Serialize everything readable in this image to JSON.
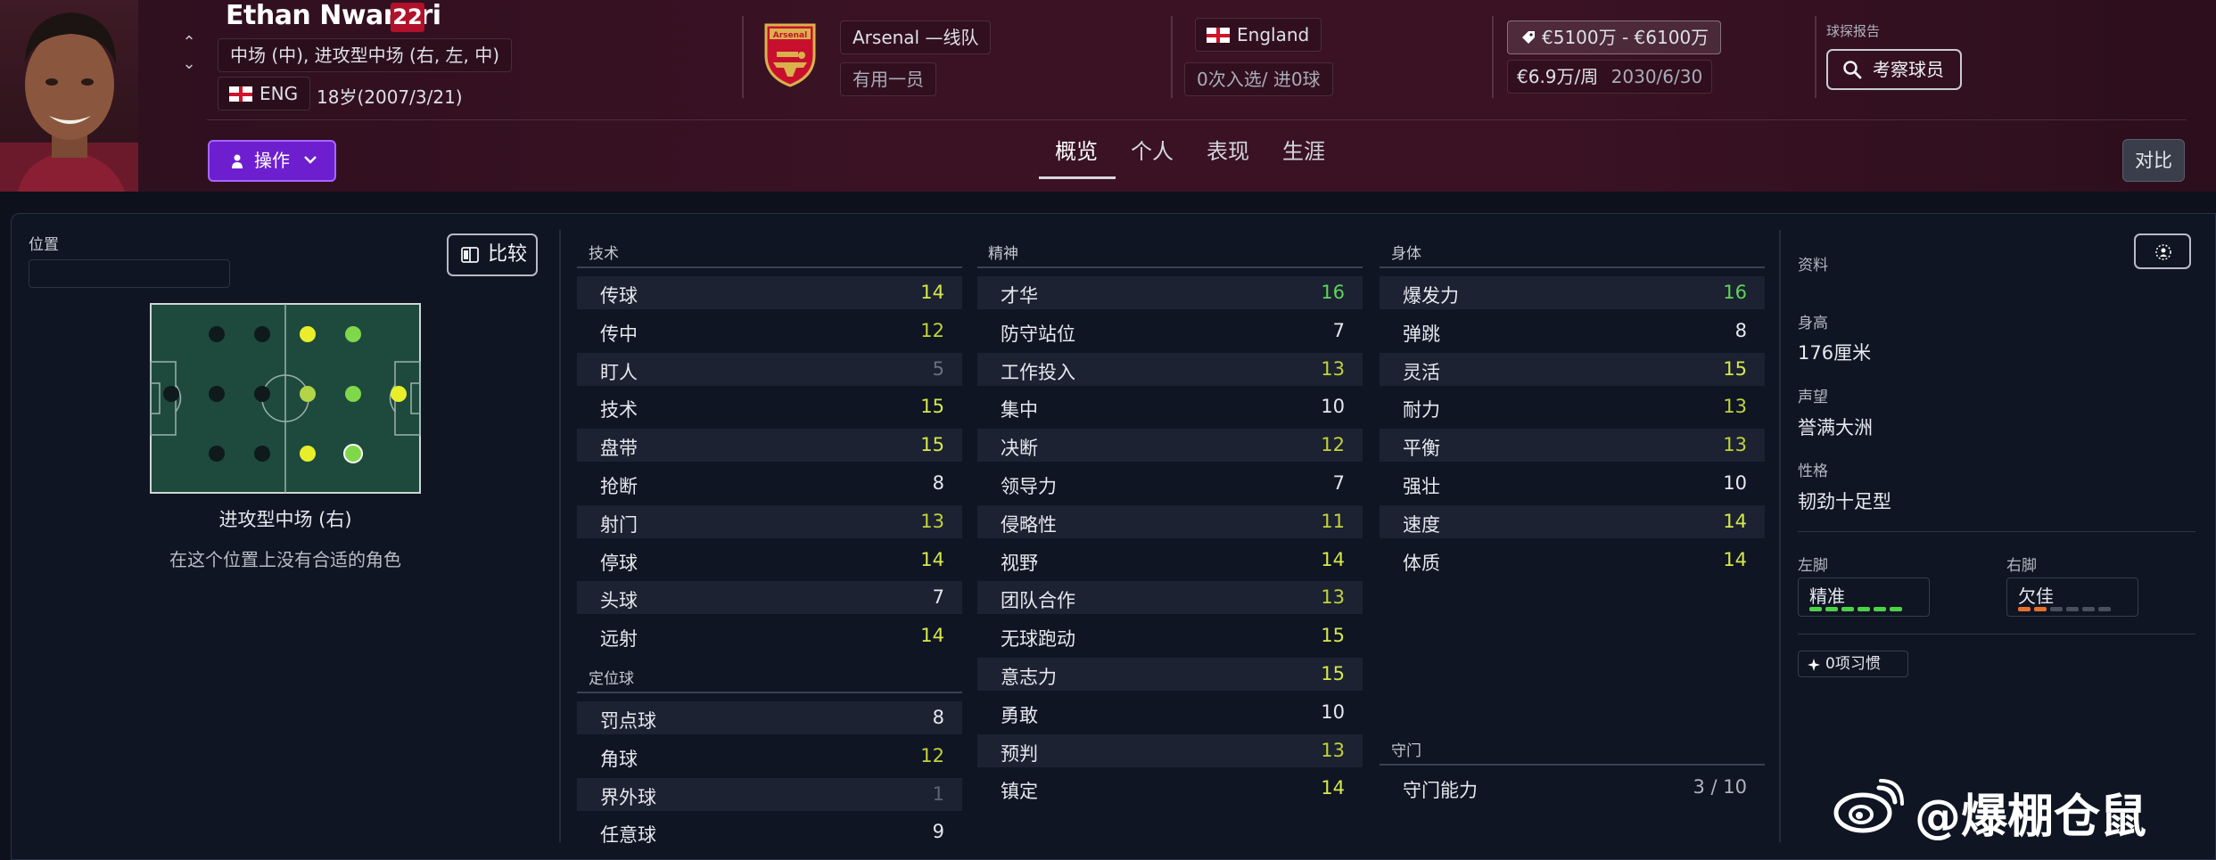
{
  "player": {
    "name": "Ethan Nwaneri",
    "number": "22",
    "positions": "中场 (中), 进攻型中场 (右, 左, 中)",
    "nation": "ENG",
    "age_birth": "18岁(2007/3/21)"
  },
  "club": {
    "name": "Arsenal —线队",
    "role": "有用一员",
    "crest_text": "Arsenal"
  },
  "international": {
    "country": "England",
    "caps": "0次入选/ 进0球"
  },
  "contract": {
    "value": "€5100万 - €6100万",
    "wage": "€6.9万/周",
    "expiry": "2030/6/30"
  },
  "scout": {
    "label": "球探报告",
    "button": "考察球员"
  },
  "actions": {
    "action_button": "操作",
    "compare_button": "对比"
  },
  "tabs": [
    {
      "label": "概览",
      "active": true
    },
    {
      "label": "个人",
      "active": false
    },
    {
      "label": "表现",
      "active": false
    },
    {
      "label": "生涯",
      "active": false
    }
  ],
  "position_panel": {
    "label": "位置",
    "compare_button": "比较",
    "position_name": "进攻型中场 (右)",
    "note": "在这个位置上没有合适的角色"
  },
  "technical": {
    "title": "技术",
    "rows": [
      {
        "name": "传球",
        "value": "14",
        "color": "#d6e84a"
      },
      {
        "name": "传中",
        "value": "12",
        "color": "#c2d23a"
      },
      {
        "name": "盯人",
        "value": "5",
        "color": "#6a707c"
      },
      {
        "name": "技术",
        "value": "15",
        "color": "#d6e84a"
      },
      {
        "name": "盘带",
        "value": "15",
        "color": "#d6e84a"
      },
      {
        "name": "抢断",
        "value": "8",
        "color": "#e6e8ee"
      },
      {
        "name": "射门",
        "value": "13",
        "color": "#c2d23a"
      },
      {
        "name": "停球",
        "value": "14",
        "color": "#d6e84a"
      },
      {
        "name": "头球",
        "value": "7",
        "color": "#e6e8ee"
      },
      {
        "name": "远射",
        "value": "14",
        "color": "#d6e84a"
      }
    ]
  },
  "set_pieces": {
    "title": "定位球",
    "rows": [
      {
        "name": "罚点球",
        "value": "8",
        "color": "#e6e8ee"
      },
      {
        "name": "角球",
        "value": "12",
        "color": "#c2d23a"
      },
      {
        "name": "界外球",
        "value": "1",
        "color": "#5d636f"
      },
      {
        "name": "任意球",
        "value": "9",
        "color": "#e6e8ee"
      }
    ]
  },
  "mental": {
    "title": "精神",
    "rows": [
      {
        "name": "才华",
        "value": "16",
        "color": "#5fd35a"
      },
      {
        "name": "防守站位",
        "value": "7",
        "color": "#e6e8ee"
      },
      {
        "name": "工作投入",
        "value": "13",
        "color": "#c2d23a"
      },
      {
        "name": "集中",
        "value": "10",
        "color": "#e6e8ee"
      },
      {
        "name": "决断",
        "value": "12",
        "color": "#c2d23a"
      },
      {
        "name": "领导力",
        "value": "7",
        "color": "#e6e8ee"
      },
      {
        "name": "侵略性",
        "value": "11",
        "color": "#c2d23a"
      },
      {
        "name": "视野",
        "value": "14",
        "color": "#d6e84a"
      },
      {
        "name": "团队合作",
        "value": "13",
        "color": "#c2d23a"
      },
      {
        "name": "无球跑动",
        "value": "15",
        "color": "#d6e84a"
      },
      {
        "name": "意志力",
        "value": "15",
        "color": "#d6e84a"
      },
      {
        "name": "勇敢",
        "value": "10",
        "color": "#e6e8ee"
      },
      {
        "name": "预判",
        "value": "13",
        "color": "#c2d23a"
      },
      {
        "name": "镇定",
        "value": "14",
        "color": "#d6e84a"
      }
    ]
  },
  "physical": {
    "title": "身体",
    "rows": [
      {
        "name": "爆发力",
        "value": "16",
        "color": "#5fd35a"
      },
      {
        "name": "弹跳",
        "value": "8",
        "color": "#e6e8ee"
      },
      {
        "name": "灵活",
        "value": "15",
        "color": "#d6e84a"
      },
      {
        "name": "耐力",
        "value": "13",
        "color": "#c2d23a"
      },
      {
        "name": "平衡",
        "value": "13",
        "color": "#c2d23a"
      },
      {
        "name": "强壮",
        "value": "10",
        "color": "#e6e8ee"
      },
      {
        "name": "速度",
        "value": "14",
        "color": "#d6e84a"
      },
      {
        "name": "体质",
        "value": "14",
        "color": "#d6e84a"
      }
    ]
  },
  "goalkeeping": {
    "title": "守门",
    "row_name": "守门能力",
    "row_value": "3 / 10"
  },
  "info": {
    "title": "资料",
    "height_label": "身高",
    "height": "176厘米",
    "reputation_label": "声望",
    "reputation": "誉满大洲",
    "personality_label": "性格",
    "personality": "韧劲十足型",
    "left_foot_label": "左脚",
    "left_foot": "精准",
    "right_foot_label": "右脚",
    "right_foot": "欠佳",
    "habits": "0项习惯"
  },
  "watermark": "@爆棚仓鼠"
}
